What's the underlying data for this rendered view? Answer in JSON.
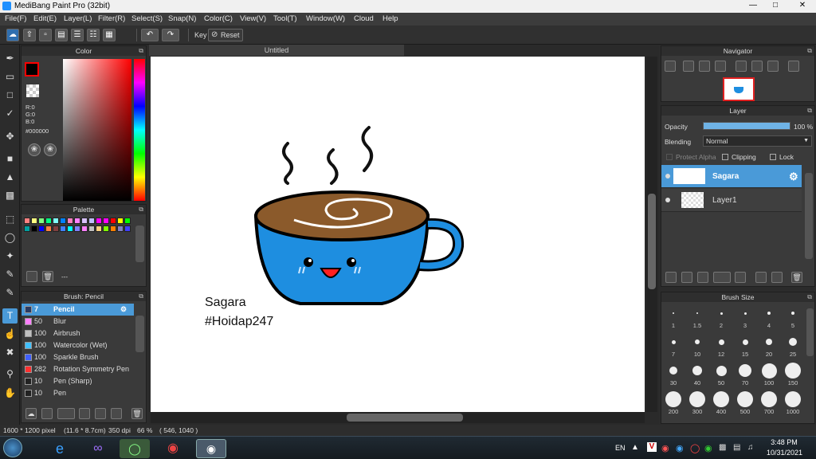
{
  "window": {
    "title": "MediBang Paint Pro (32bit)"
  },
  "menu": [
    "File(F)",
    "Edit(E)",
    "Layer(L)",
    "Filter(R)",
    "Select(S)",
    "Snap(N)",
    "Color(C)",
    "View(V)",
    "Tool(T)",
    "Window(W)",
    "Cloud",
    "Help"
  ],
  "toolbar": {
    "key_label": "Key",
    "reset_label": "Reset"
  },
  "color_panel": {
    "title": "Color",
    "r": "R:0",
    "g": "G:0",
    "b": "B:0",
    "hex": "#000000",
    "current_color": "#000000"
  },
  "palette_panel": {
    "title": "Palette",
    "name": "---",
    "swatches": [
      "#ff8080",
      "#ffff80",
      "#80ff80",
      "#00ff80",
      "#80ffff",
      "#0080ff",
      "#ff80c0",
      "#ff80ff",
      "#d8c0ff",
      "#c0c0ff",
      "#ff00ff",
      "#ff00ff",
      "#ff0000",
      "#ffff00",
      "#00ff00",
      "#00a0a0",
      "#000000",
      "#0000ff",
      "#ff8040",
      "#804040",
      "#4080ff",
      "#00ffff",
      "#8080ff",
      "#ff80ff",
      "#c0c0c0",
      "#ffd080",
      "#80ff00",
      "#ff8000",
      "#8080c0",
      "#4040ff"
    ]
  },
  "brush_panel": {
    "title": "Brush: Pencil",
    "brushes": [
      {
        "size": "7",
        "name": "Pencil",
        "color": "#2b3a60"
      },
      {
        "size": "50",
        "name": "Blur",
        "color": "#ff80ff"
      },
      {
        "size": "100",
        "name": "Airbrush",
        "color": "#c0c0c0"
      },
      {
        "size": "100",
        "name": "Watercolor (Wet)",
        "color": "#40c0ff"
      },
      {
        "size": "100",
        "name": "Sparkle Brush",
        "color": "#4060ff"
      },
      {
        "size": "282",
        "name": "Rotation Symmetry Pen",
        "color": "#ff3030"
      },
      {
        "size": "10",
        "name": "Pen (Sharp)",
        "color": "#222222"
      },
      {
        "size": "10",
        "name": "Pen",
        "color": "#222222"
      }
    ]
  },
  "canvas": {
    "tab": "Untitled",
    "text_line1": "Sagara",
    "text_line2": "#Hoidap247"
  },
  "navigator_panel": {
    "title": "Navigator"
  },
  "layer_panel": {
    "title": "Layer",
    "opacity_label": "Opacity",
    "opacity_value": "100 %",
    "opacity_fraction": 1.0,
    "blending_label": "Blending",
    "blending_value": "Normal",
    "protect_alpha": "Protect Alpha",
    "clipping": "Clipping",
    "lock": "Lock",
    "layers": [
      {
        "name": "Sagara"
      },
      {
        "name": "Layer1"
      }
    ]
  },
  "brushsize_panel": {
    "title": "Brush Size",
    "sizes": [
      "1",
      "1.5",
      "2",
      "3",
      "4",
      "5",
      "7",
      "10",
      "12",
      "15",
      "20",
      "25",
      "30",
      "40",
      "50",
      "70",
      "100",
      "150",
      "200",
      "300",
      "400",
      "500",
      "700",
      "1000"
    ]
  },
  "status": {
    "dimensions": "1600 * 1200 pixel",
    "physical": "(11.6 * 8.7cm)",
    "dpi": "350 dpi",
    "zoom": "66 %",
    "coords": "( 546, 1040 )"
  },
  "taskbar": {
    "lang": "EN",
    "time": "3:48 PM",
    "date": "10/31/2021"
  },
  "colors": {
    "accent": "#4a9ad8",
    "cup_blue": "#1e8ee0",
    "coffee": "#8b5a2b"
  }
}
